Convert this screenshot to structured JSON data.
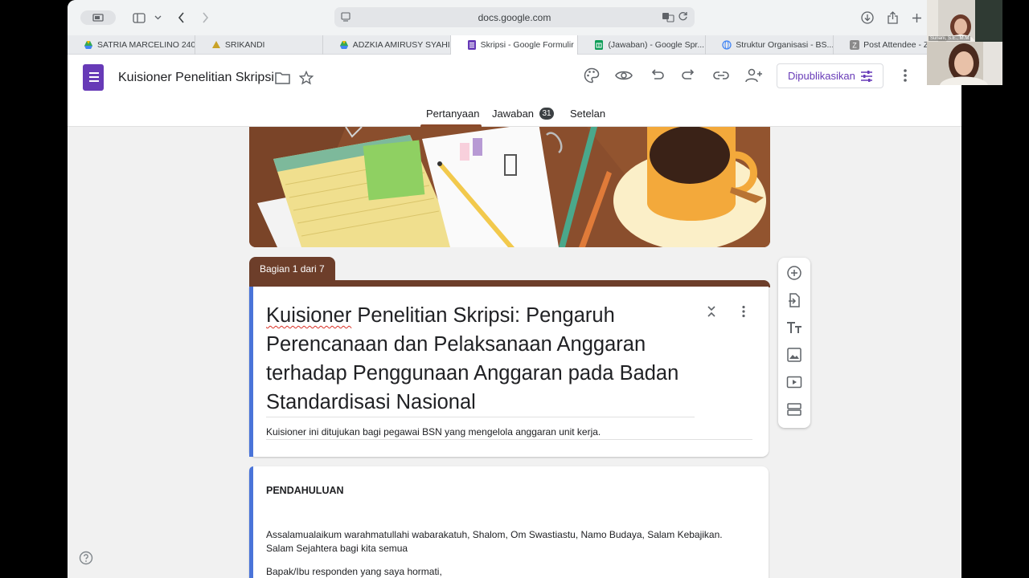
{
  "browser": {
    "url": "docs.google.com",
    "tabs": [
      {
        "label": "SATRIA MARCELINO 240...",
        "icon": "drive-icon",
        "color": "#34a853"
      },
      {
        "label": "SRIKANDI",
        "icon": "srikandi-icon",
        "color": "#c9a227"
      },
      {
        "label": "ADZKIA AMIRUSY SYAHI...",
        "icon": "drive-icon",
        "color": "#34a853"
      },
      {
        "label": "Skripsi - Google Formulir",
        "icon": "forms-icon",
        "color": "#673ab7",
        "active": true
      },
      {
        "label": "(Jawaban) - Google Spr...",
        "icon": "sheets-icon",
        "color": "#0f9d58"
      },
      {
        "label": "Struktur Organisasi - BS...",
        "icon": "globe-icon",
        "color": "#4285f4"
      },
      {
        "label": "Post Attendee - Z",
        "icon": "zoom-icon",
        "color": "#6b6b6b"
      }
    ]
  },
  "form_header": {
    "title": "Kuisioner Penelitian Skripsi",
    "publish_label": "Dipublikasikan",
    "nav": {
      "questions": "Pertanyaan",
      "responses": "Jawaban",
      "responses_count": "31",
      "settings": "Setelan"
    }
  },
  "section": {
    "tag": "Bagian 1 dari 7"
  },
  "title_card": {
    "title_first_word": "Kuisioner",
    "title_rest": " Penelitian Skripsi: Pengaruh Perencanaan dan Pelaksanaan Anggaran terhadap Penggunaan Anggaran pada Badan Standardisasi Nasional",
    "description": "Kuisioner ini ditujukan bagi pegawai BSN yang mengelola anggaran unit kerja."
  },
  "intro_card": {
    "title": "PENDAHULUAN",
    "body": "Assalamualaikum warahmatullahi wabarakatuh, Shalom, Om Swastiastu, Namo Budaya, Salam Kebajikan. Salam Sejahtera bagi kita semua",
    "next_line": "Bapak/Ibu responden yang saya hormati,"
  },
  "webcam": {
    "name": "Suriani, S.E., M.M"
  },
  "colors": {
    "accent_purple": "#673ab7",
    "section_brown": "#6d3e2a",
    "card_accent_blue": "#4a74d9"
  }
}
